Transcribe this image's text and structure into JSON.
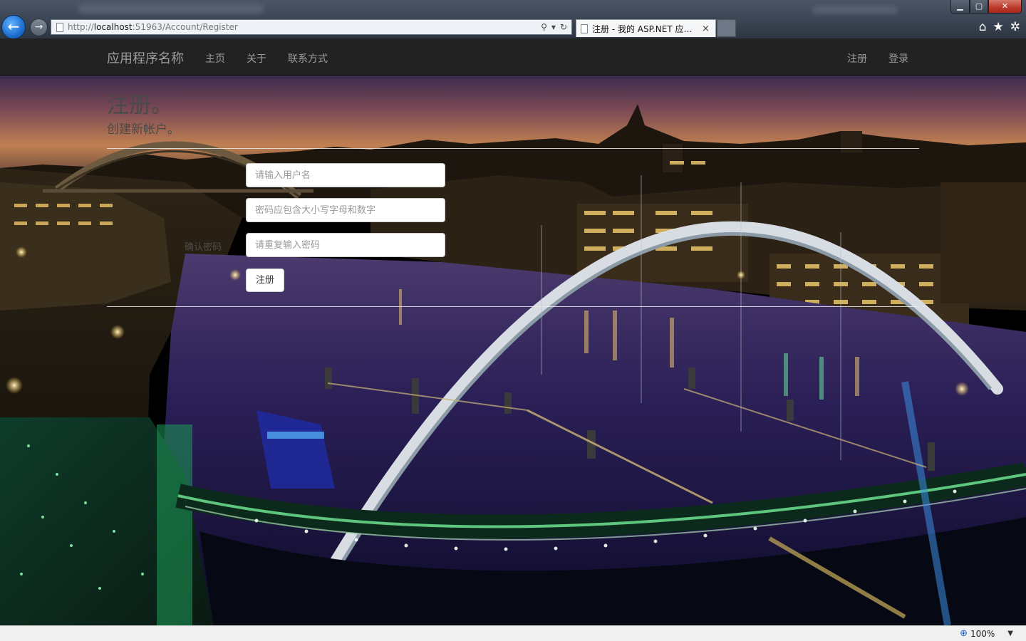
{
  "browser": {
    "address": {
      "prefix": "http://",
      "host": "localhost",
      "rest": ":51963/Account/Register"
    },
    "tab_title": "注册 - 我的 ASP.NET 应用...",
    "tab_close": "×",
    "window_buttons": {
      "minimize": "▁",
      "maximize": "▢",
      "close": "✕"
    },
    "toolbar_icons": {
      "home": "home-icon",
      "favorites": "star-icon",
      "tools": "gear-icon"
    },
    "zoom": "100%"
  },
  "navbar": {
    "brand": "应用程序名称",
    "left_links": [
      "主页",
      "关于",
      "联系方式"
    ],
    "right_links": [
      "注册",
      "登录"
    ]
  },
  "page": {
    "title": "注册。",
    "subtitle": "创建新帐户。",
    "username_placeholder": "请输入用户名",
    "password_placeholder": "密码应包含大小写字母和数字",
    "confirm_placeholder": "请重复输入密码",
    "confirm_label": "确认密码",
    "submit_label": "注册"
  },
  "colors": {
    "navbar_bg": "#222222",
    "navbar_text": "#9d9d9d",
    "heading_text": "#4a4a4a"
  }
}
